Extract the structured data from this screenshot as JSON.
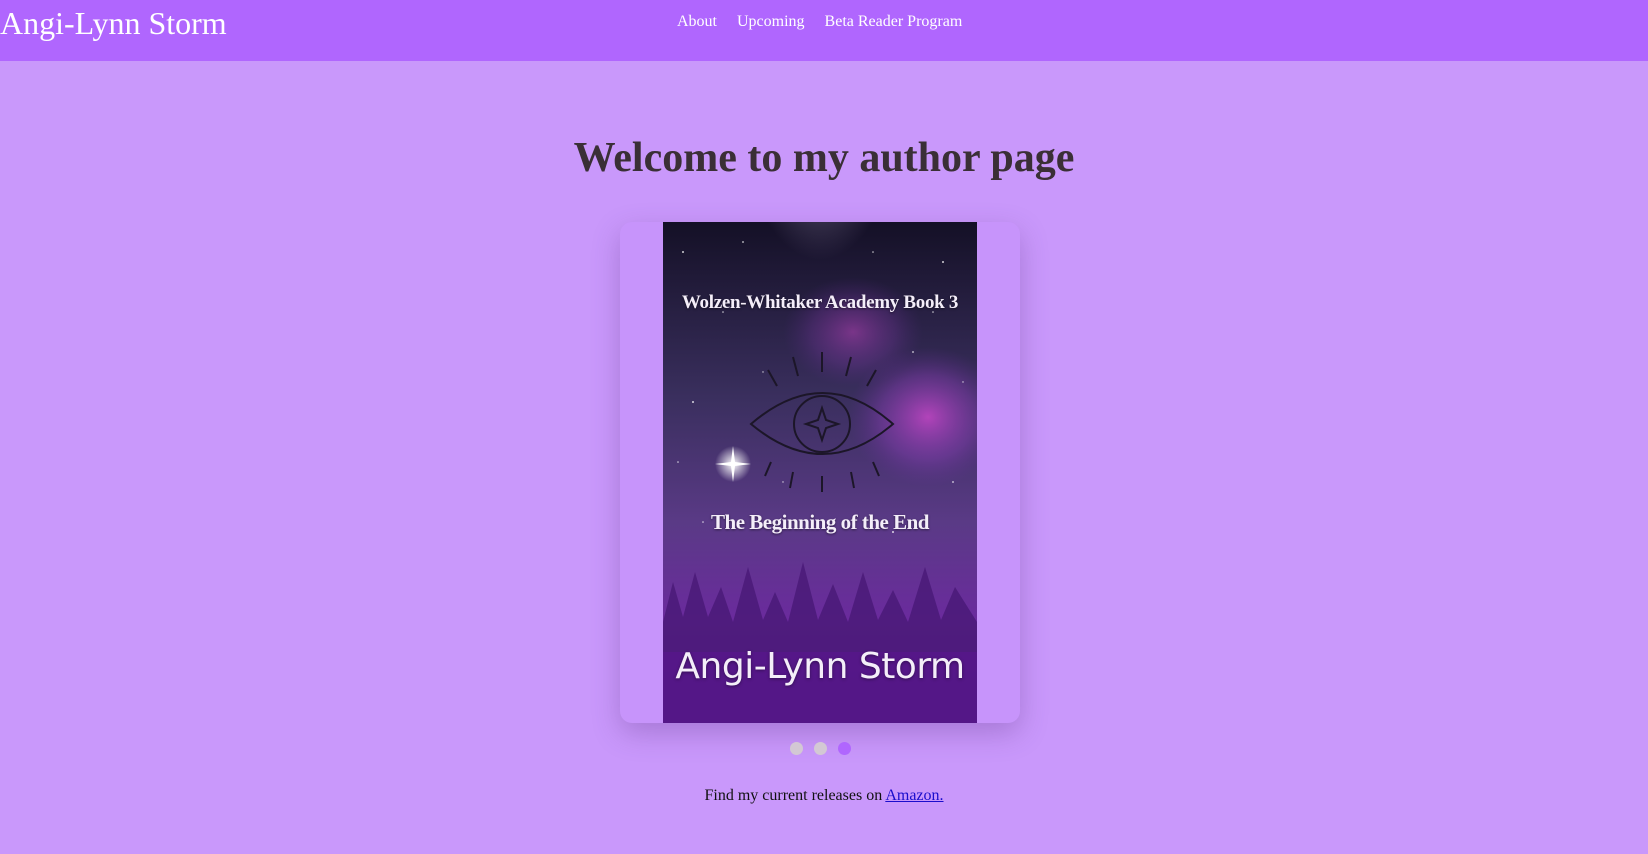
{
  "header": {
    "brand": "Angi-Lynn Storm",
    "nav": [
      {
        "label": "About"
      },
      {
        "label": "Upcoming"
      },
      {
        "label": "Beta Reader Program"
      }
    ]
  },
  "main": {
    "title": "Welcome to my author page",
    "carousel": {
      "current_slide": 3,
      "slide_count": 3,
      "book": {
        "series": "Wolzen-Whitaker Academy Book 3",
        "subtitle": "The Beginning of the End",
        "author": "Angi-Lynn Storm"
      }
    },
    "footer": {
      "text": "Find my current releases on ",
      "link_label": "Amazon."
    }
  },
  "colors": {
    "navbar": "#b066fe",
    "page_background": "#c998fb",
    "active_dot": "#b066fe",
    "inactive_dot": "#d3c8d4"
  }
}
